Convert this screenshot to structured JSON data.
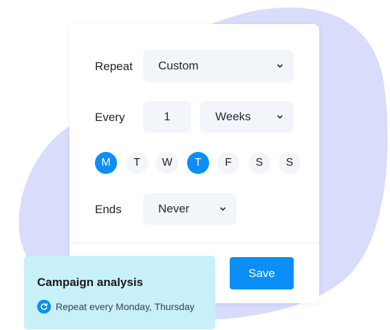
{
  "colors": {
    "accent": "#0b8ef5",
    "blob": "#d9dcfb",
    "field_bg": "#f2f5f9",
    "popup_bg": "#c8f0f9"
  },
  "form": {
    "repeat": {
      "label": "Repeat",
      "value": "Custom"
    },
    "every": {
      "label": "Every",
      "number": "1",
      "unit": "Weeks"
    },
    "days": [
      {
        "label": "M",
        "selected": true
      },
      {
        "label": "T",
        "selected": false
      },
      {
        "label": "W",
        "selected": false
      },
      {
        "label": "T",
        "selected": true
      },
      {
        "label": "F",
        "selected": false
      },
      {
        "label": "S",
        "selected": false
      },
      {
        "label": "S",
        "selected": false
      }
    ],
    "ends": {
      "label": "Ends",
      "value": "Never"
    },
    "save_label": "Save"
  },
  "popup": {
    "title": "Campaign analysis",
    "summary": "Repeat every Monday, Thursday",
    "icon": "repeat-icon"
  }
}
